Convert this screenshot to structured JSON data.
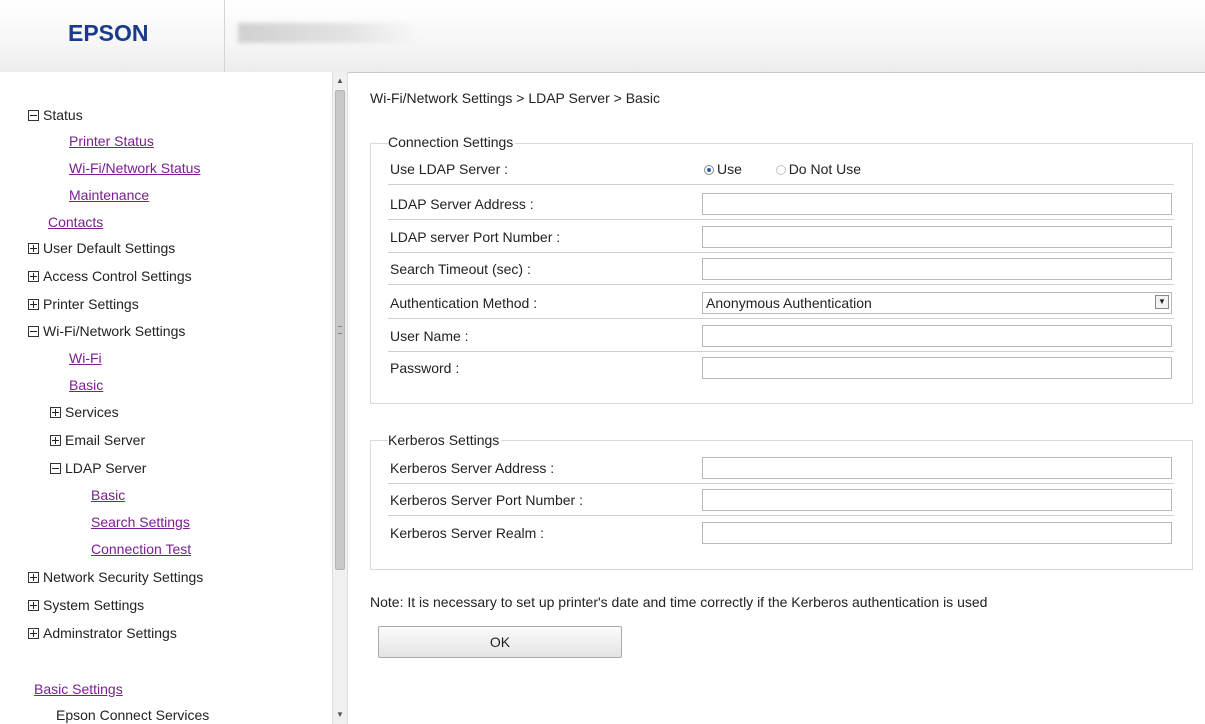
{
  "header": {
    "logo": "EPSON",
    "model_name": ""
  },
  "sidebar": {
    "items": [
      {
        "label": "Status"
      },
      {
        "label": "Printer Status"
      },
      {
        "label": "Wi-Fi/Network Status"
      },
      {
        "label": "Maintenance"
      },
      {
        "label": "Contacts"
      },
      {
        "label": "User Default Settings"
      },
      {
        "label": "Access Control Settings"
      },
      {
        "label": "Printer Settings"
      },
      {
        "label": "Wi-Fi/Network Settings"
      },
      {
        "label": "Wi-Fi"
      },
      {
        "label": "Basic"
      },
      {
        "label": "Services"
      },
      {
        "label": "Email Server"
      },
      {
        "label": "LDAP Server"
      },
      {
        "label": "Basic"
      },
      {
        "label": "Search Settings"
      },
      {
        "label": "Connection Test"
      },
      {
        "label": "Network Security Settings"
      },
      {
        "label": "System Settings"
      },
      {
        "label": "Adminstrator Settings"
      },
      {
        "label": "Basic Settings"
      },
      {
        "label": "Epson Connect Services"
      }
    ]
  },
  "main": {
    "breadcrumb": "Wi-Fi/Network Settings > LDAP Server > Basic",
    "connection": {
      "legend": "Connection Settings",
      "use_ldap_label": "Use LDAP Server :",
      "use_option": "Use",
      "do_not_use_option": "Do Not Use",
      "use_selected": true,
      "server_address_label": "LDAP Server Address :",
      "server_address_value": "",
      "port_label": "LDAP server Port Number :",
      "port_value": "",
      "timeout_label": "Search Timeout (sec) :",
      "timeout_value": "",
      "auth_method_label": "Authentication Method :",
      "auth_method_value": "Anonymous Authentication",
      "user_name_label": "User Name :",
      "user_name_value": "",
      "password_label": "Password :",
      "password_value": ""
    },
    "kerberos": {
      "legend": "Kerberos Settings",
      "server_address_label": "Kerberos Server Address :",
      "server_address_value": "",
      "port_label": "Kerberos Server Port Number :",
      "port_value": "",
      "realm_label": "Kerberos Server Realm :",
      "realm_value": ""
    },
    "note": "Note: It is necessary to set up printer's date and time correctly if the Kerberos authentication is used",
    "ok_label": "OK"
  },
  "icons": {
    "expanded": "minus-box-icon",
    "collapsed": "plus-box-icon",
    "radio_checked": "radio-checked-icon",
    "dropdown": "dropdown-arrow-icon"
  },
  "colors": {
    "link": "#7a1f8f",
    "logo": "#1a3a8c"
  }
}
